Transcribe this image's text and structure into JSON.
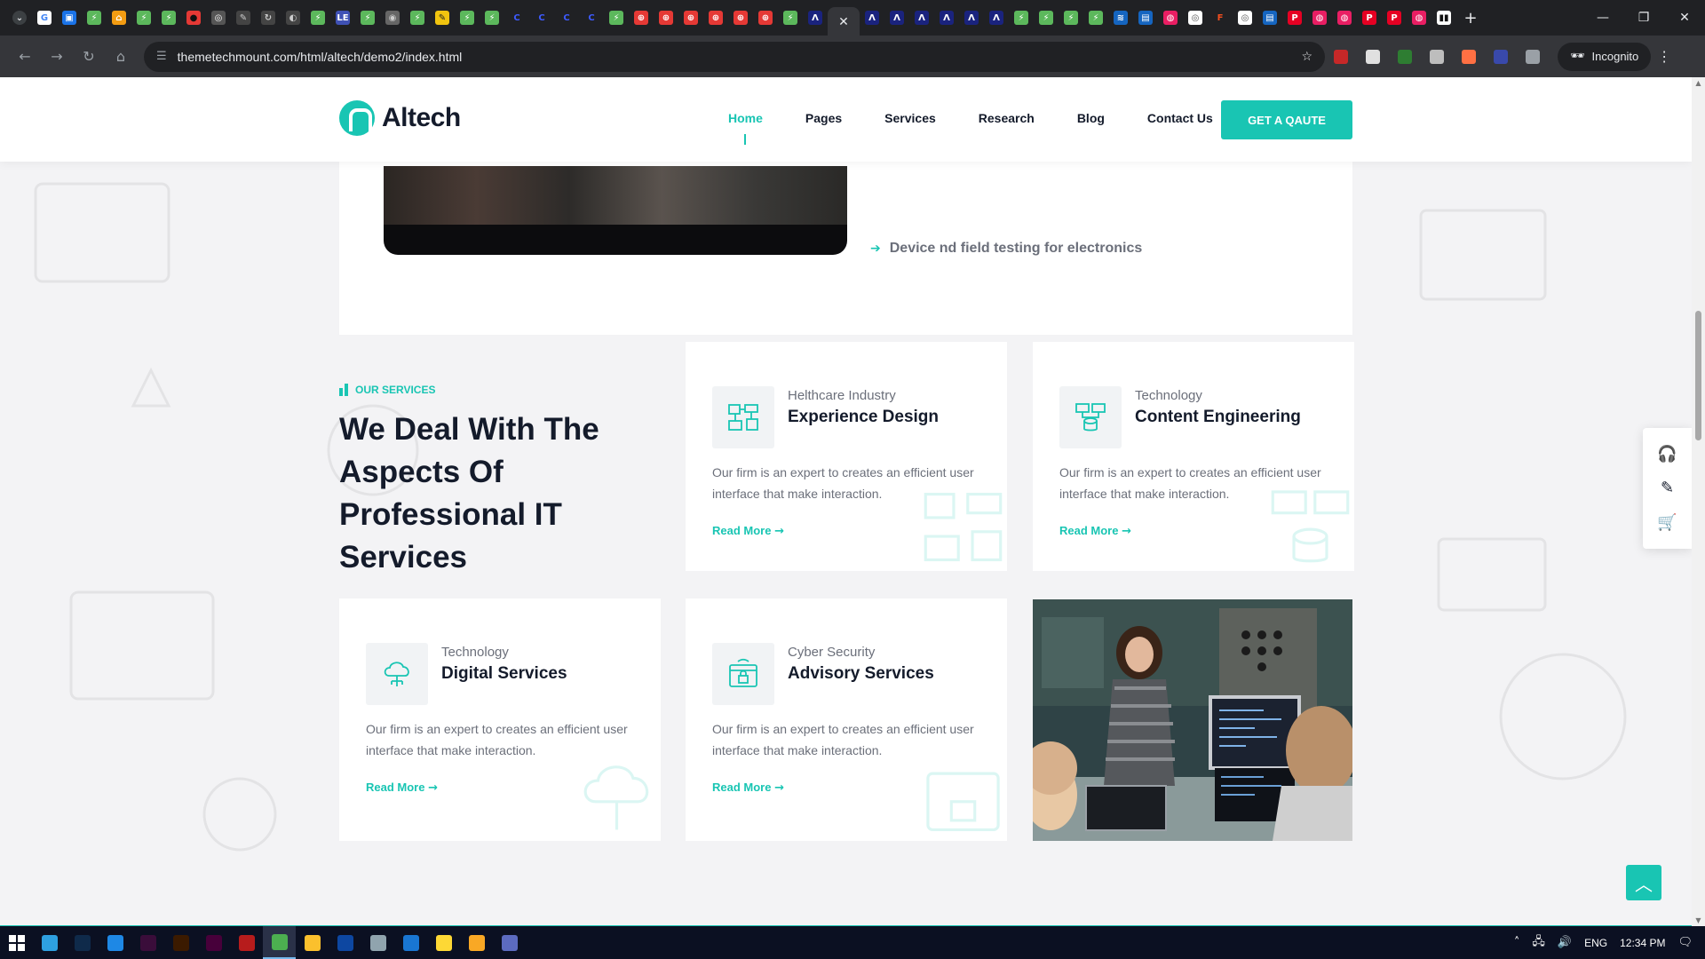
{
  "browser": {
    "url": "themetechmount.com/html/altech/demo2/index.html",
    "incognito_label": "Incognito",
    "active_tab_close": "✕",
    "new_tab_symbol": "+",
    "favicons": [
      {
        "color": "#ffffff",
        "glyph": "G",
        "fg": "#4285f4"
      },
      {
        "color": "#1a73e8",
        "glyph": "▣",
        "fg": "#fff"
      },
      {
        "color": "#5cb85c",
        "glyph": "⚡",
        "fg": "#fff"
      },
      {
        "color": "#f39c12",
        "glyph": "⌂",
        "fg": "#fff"
      },
      {
        "color": "#5cb85c",
        "glyph": "⚡",
        "fg": "#fff"
      },
      {
        "color": "#5cb85c",
        "glyph": "⚡",
        "fg": "#fff"
      },
      {
        "color": "#e53935",
        "glyph": "●",
        "fg": "#111"
      },
      {
        "color": "#555",
        "glyph": "◎",
        "fg": "#fff"
      },
      {
        "color": "#444",
        "glyph": "✎",
        "fg": "#ccc"
      },
      {
        "color": "#444",
        "glyph": "↻",
        "fg": "#ccc"
      },
      {
        "color": "#444",
        "glyph": "◐",
        "fg": "#ccc"
      },
      {
        "color": "#5cb85c",
        "glyph": "⚡",
        "fg": "#fff"
      },
      {
        "color": "#3f51b5",
        "glyph": "LE",
        "fg": "#fff"
      },
      {
        "color": "#5cb85c",
        "glyph": "⚡",
        "fg": "#fff"
      },
      {
        "color": "#666",
        "glyph": "◉",
        "fg": "#ccc"
      },
      {
        "color": "#5cb85c",
        "glyph": "⚡",
        "fg": "#fff"
      },
      {
        "color": "#f1c40f",
        "glyph": "✎",
        "fg": "#222"
      },
      {
        "color": "#5cb85c",
        "glyph": "⚡",
        "fg": "#fff"
      },
      {
        "color": "#5cb85c",
        "glyph": "⚡",
        "fg": "#fff"
      },
      {
        "color": "#202124",
        "glyph": "C",
        "fg": "#3d5afe"
      },
      {
        "color": "#202124",
        "glyph": "C",
        "fg": "#3d5afe"
      },
      {
        "color": "#202124",
        "glyph": "C",
        "fg": "#3d5afe"
      },
      {
        "color": "#202124",
        "glyph": "C",
        "fg": "#3d5afe"
      },
      {
        "color": "#5cb85c",
        "glyph": "⚡",
        "fg": "#fff"
      },
      {
        "color": "#e53935",
        "glyph": "⊕",
        "fg": "#fff"
      },
      {
        "color": "#e53935",
        "glyph": "⊕",
        "fg": "#fff"
      },
      {
        "color": "#e53935",
        "glyph": "⊕",
        "fg": "#fff"
      },
      {
        "color": "#e53935",
        "glyph": "⊕",
        "fg": "#fff"
      },
      {
        "color": "#e53935",
        "glyph": "⊕",
        "fg": "#fff"
      },
      {
        "color": "#e53935",
        "glyph": "⊕",
        "fg": "#fff"
      },
      {
        "color": "#5cb85c",
        "glyph": "⚡",
        "fg": "#fff"
      },
      {
        "color": "#1a237e",
        "glyph": "Λ",
        "fg": "#fff"
      }
    ],
    "favicons_after": [
      {
        "color": "#1a237e",
        "glyph": "Λ",
        "fg": "#fff"
      },
      {
        "color": "#1a237e",
        "glyph": "Λ",
        "fg": "#fff"
      },
      {
        "color": "#1a237e",
        "glyph": "Λ",
        "fg": "#fff"
      },
      {
        "color": "#1a237e",
        "glyph": "Λ",
        "fg": "#fff"
      },
      {
        "color": "#1a237e",
        "glyph": "Λ",
        "fg": "#fff"
      },
      {
        "color": "#1a237e",
        "glyph": "Λ",
        "fg": "#fff"
      },
      {
        "color": "#5cb85c",
        "glyph": "⚡",
        "fg": "#fff"
      },
      {
        "color": "#5cb85c",
        "glyph": "⚡",
        "fg": "#fff"
      },
      {
        "color": "#5cb85c",
        "glyph": "⚡",
        "fg": "#fff"
      },
      {
        "color": "#5cb85c",
        "glyph": "⚡",
        "fg": "#fff"
      },
      {
        "color": "#1565c0",
        "glyph": "≋",
        "fg": "#fff"
      },
      {
        "color": "#1565c0",
        "glyph": "▤",
        "fg": "#fff"
      },
      {
        "color": "#e91e63",
        "glyph": "◍",
        "fg": "#fff"
      },
      {
        "color": "#fff",
        "glyph": "◎",
        "fg": "#555"
      },
      {
        "color": "#202124",
        "glyph": "F",
        "fg": "#f24e1e"
      },
      {
        "color": "#fff",
        "glyph": "◎",
        "fg": "#555"
      },
      {
        "color": "#1565c0",
        "glyph": "▤",
        "fg": "#fff"
      },
      {
        "color": "#e60023",
        "glyph": "P",
        "fg": "#fff"
      },
      {
        "color": "#e91e63",
        "glyph": "◍",
        "fg": "#fff"
      },
      {
        "color": "#e91e63",
        "glyph": "◍",
        "fg": "#fff"
      },
      {
        "color": "#e60023",
        "glyph": "P",
        "fg": "#fff"
      },
      {
        "color": "#e60023",
        "glyph": "P",
        "fg": "#fff"
      },
      {
        "color": "#e91e63",
        "glyph": "◍",
        "fg": "#fff"
      },
      {
        "color": "#fff",
        "glyph": "▮▮",
        "fg": "#111"
      }
    ]
  },
  "site": {
    "brand": "Altech",
    "nav": [
      "Home",
      "Pages",
      "Services",
      "Research",
      "Blog",
      "Contact Us"
    ],
    "active_nav": "Home",
    "cta": "GET A QAUTE",
    "accent": "#19c5b3"
  },
  "top_card": {
    "bullet": "Device nd field testing for electronics"
  },
  "services": {
    "tag": "OUR SERVICES",
    "title": "We Deal With The Aspects Of Professional IT Services",
    "cards": [
      {
        "category": "Helthcare Industry",
        "title": "Experience Design",
        "desc": "Our firm is an expert to creates an efficient user interface that make interaction.",
        "link": "Read More",
        "icon": "network-icon"
      },
      {
        "category": "Technology",
        "title": "Content Engineering",
        "desc": "Our firm is an expert to creates an efficient user interface that make interaction.",
        "link": "Read More",
        "icon": "database-icon"
      },
      {
        "category": "Technology",
        "title": "Digital Services",
        "desc": "Our firm is an expert to creates an efficient user interface that make interaction.",
        "link": "Read More",
        "icon": "cloud-icon"
      },
      {
        "category": "Cyber Security",
        "title": "Advisory Services",
        "desc": "Our firm is an expert to creates an efficient user interface that make interaction.",
        "link": "Read More",
        "icon": "lock-screen-icon"
      }
    ]
  },
  "floating": {
    "icons": [
      "headset-icon",
      "pencil-icon",
      "cart-icon"
    ],
    "to_top": "︿"
  },
  "taskbar": {
    "apps": [
      {
        "name": "edge",
        "color": "#2ea0e0"
      },
      {
        "name": "photoshop",
        "color": "#0f2a4a"
      },
      {
        "name": "vscode-check",
        "color": "#1e88e5"
      },
      {
        "name": "dreamweaver",
        "color": "#3a0d3a"
      },
      {
        "name": "illustrator",
        "color": "#3b1a00"
      },
      {
        "name": "xd",
        "color": "#47003a"
      },
      {
        "name": "filezilla",
        "color": "#b71c1c"
      },
      {
        "name": "chrome",
        "color": "#4caf50"
      },
      {
        "name": "sticky-notes",
        "color": "#fbc02d"
      },
      {
        "name": "outlook",
        "color": "#0d47a1"
      },
      {
        "name": "notepad",
        "color": "#90a4ae"
      },
      {
        "name": "vscode",
        "color": "#1976d2"
      },
      {
        "name": "chrome-2",
        "color": "#fdd835"
      },
      {
        "name": "file-explorer",
        "color": "#f9a825"
      },
      {
        "name": "teams",
        "color": "#5c6bc0"
      }
    ],
    "lang": "ENG",
    "time": "12:34 PM"
  }
}
